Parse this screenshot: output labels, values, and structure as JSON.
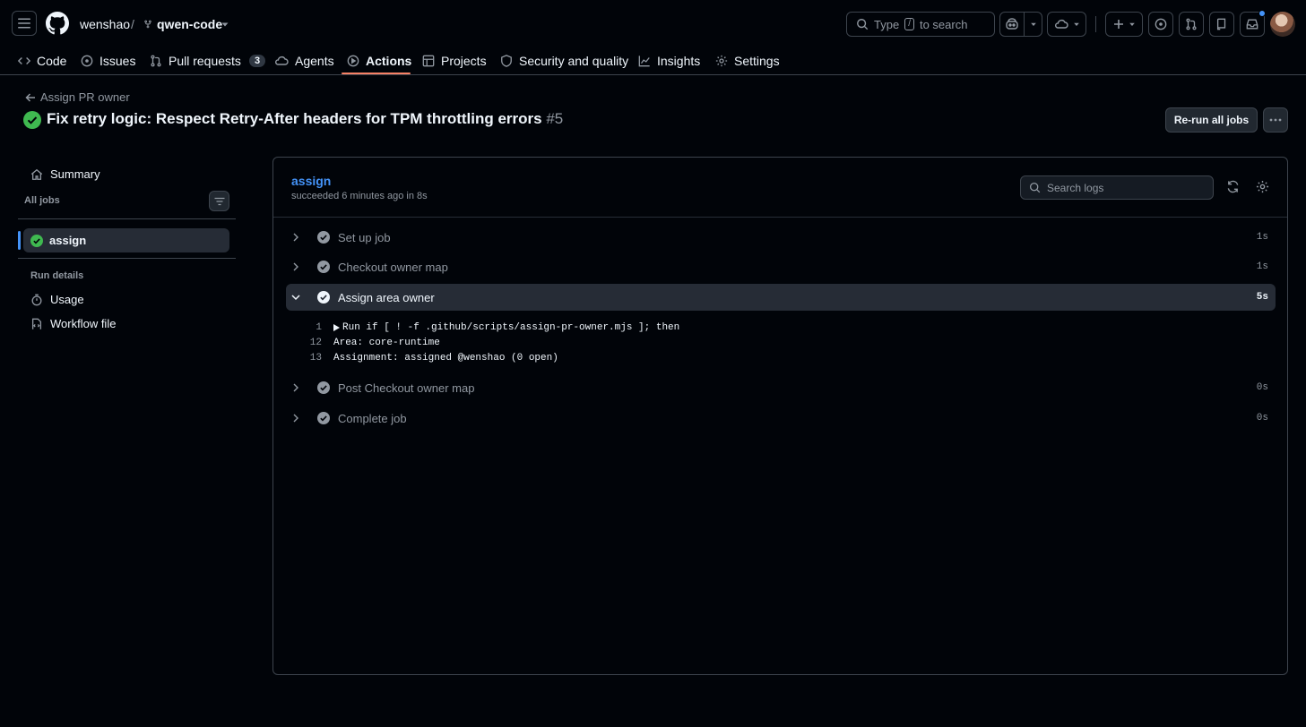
{
  "header": {
    "owner": "wenshao",
    "separator": "/",
    "repo": "qwen-code",
    "search_prefix": "Type",
    "search_key": "/",
    "search_suffix": "to search"
  },
  "nav": {
    "tabs": [
      {
        "label": "Code",
        "icon": "code-icon"
      },
      {
        "label": "Issues",
        "icon": "issue-icon"
      },
      {
        "label": "Pull requests",
        "icon": "pull-request-icon",
        "count": "3"
      },
      {
        "label": "Agents",
        "icon": "agents-icon"
      },
      {
        "label": "Actions",
        "icon": "play-icon",
        "active": true
      },
      {
        "label": "Projects",
        "icon": "table-icon"
      },
      {
        "label": "Security and quality",
        "icon": "shield-icon"
      },
      {
        "label": "Insights",
        "icon": "graph-icon"
      },
      {
        "label": "Settings",
        "icon": "gear-icon"
      }
    ]
  },
  "run": {
    "back_label": "Assign PR owner",
    "title": "Fix retry logic: Respect Retry-After headers for TPM throttling errors",
    "number": "#5",
    "rerun_label": "Re-run all jobs"
  },
  "sidebar": {
    "summary_label": "Summary",
    "all_jobs_label": "All jobs",
    "job_label": "assign",
    "run_details_label": "Run details",
    "usage_label": "Usage",
    "workflow_file_label": "Workflow file"
  },
  "job": {
    "name": "assign",
    "status": "succeeded 6 minutes ago in 8s",
    "search_placeholder": "Search logs",
    "steps": [
      {
        "name": "Set up job",
        "duration": "1s"
      },
      {
        "name": "Checkout owner map",
        "duration": "1s"
      },
      {
        "name": "Assign area owner",
        "duration": "5s",
        "expanded": true
      },
      {
        "name": "Post Checkout owner map",
        "duration": "0s"
      },
      {
        "name": "Complete job",
        "duration": "0s"
      }
    ],
    "log_lines": [
      {
        "num": "1",
        "text": "Run if [ ! -f .github/scripts/assign-pr-owner.mjs ]; then",
        "collapsible": true
      },
      {
        "num": "12",
        "text": "Area: core-runtime"
      },
      {
        "num": "13",
        "text": "Assignment: assigned @wenshao (0 open)"
      }
    ]
  },
  "colors": {
    "bg": "#010409",
    "success": "#3fb950",
    "accent_link": "#4493f8",
    "tab_underline": "#f78166",
    "notification_dot": "#4493f8"
  }
}
